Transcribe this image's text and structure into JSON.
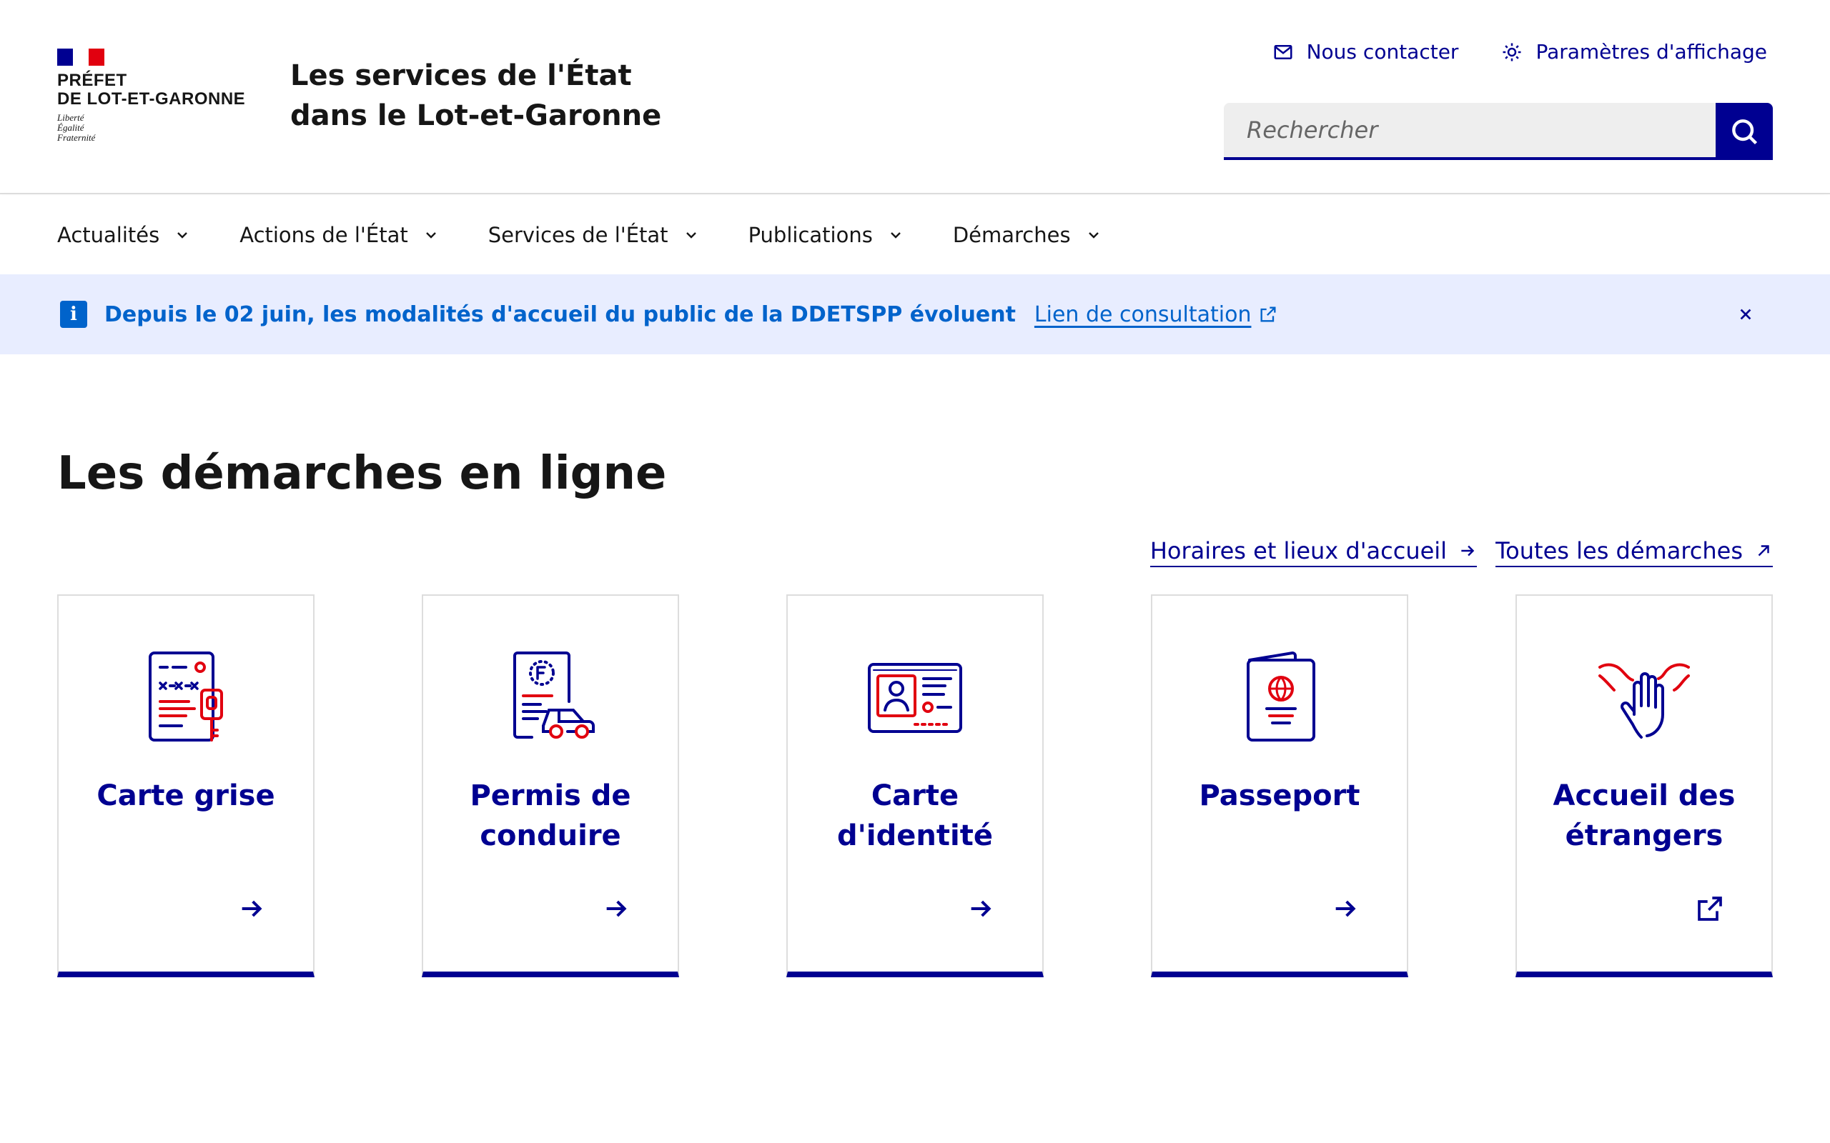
{
  "header": {
    "logo_line1": "PRÉFET",
    "logo_line2": "DE LOT-ET-GARONNE",
    "devise_1": "Liberté",
    "devise_2": "Égalité",
    "devise_3": "Fraternité",
    "site_title_1": "Les services de l'État",
    "site_title_2": "dans le Lot-et-Garonne",
    "contact_label": "Nous contacter",
    "display_settings_label": "Paramètres d'affichage",
    "search_placeholder": "Rechercher"
  },
  "nav": {
    "items": [
      {
        "label": "Actualités"
      },
      {
        "label": "Actions de l'État"
      },
      {
        "label": "Services de l'État"
      },
      {
        "label": "Publications"
      },
      {
        "label": "Démarches"
      }
    ]
  },
  "notice": {
    "text": "Depuis le 02 juin, les modalités d'accueil du public de la DDETSPP évoluent",
    "link_label": "Lien de consultation"
  },
  "main": {
    "title": "Les démarches en ligne",
    "links": [
      {
        "label": "Horaires et lieux d'accueil"
      },
      {
        "label": "Toutes les démarches"
      }
    ],
    "cards": [
      {
        "title": "Carte grise",
        "icon": "vehicle-registration-icon",
        "arrow": "arrow-right-icon"
      },
      {
        "title": "Permis de conduire",
        "icon": "driving-license-icon",
        "arrow": "arrow-right-icon"
      },
      {
        "title": "Carte d'identité",
        "icon": "identity-card-icon",
        "arrow": "arrow-right-icon"
      },
      {
        "title": "Passeport",
        "icon": "passport-icon",
        "arrow": "arrow-right-icon"
      },
      {
        "title": "Accueil des étrangers",
        "icon": "foreigners-welcome-icon",
        "arrow": "external-link-icon"
      }
    ]
  },
  "colors": {
    "primary": "#000091",
    "accent_red": "#e1000f",
    "info": "#0063cb",
    "notice_bg": "#e8edff"
  }
}
